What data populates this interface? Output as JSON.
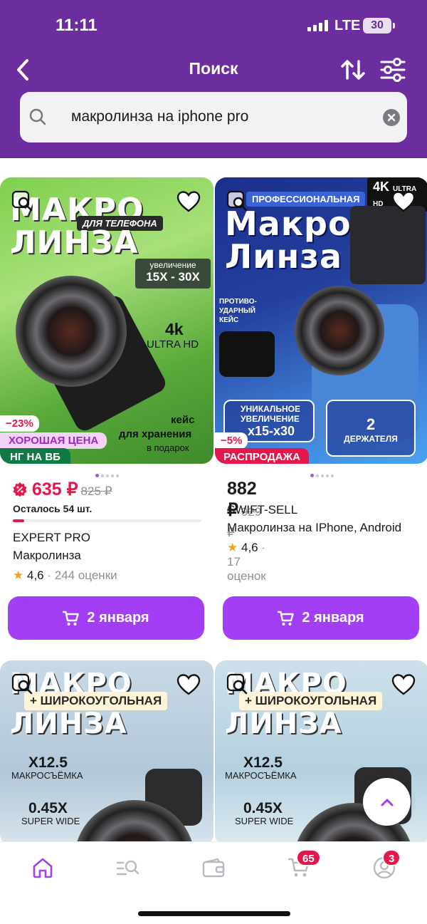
{
  "status_bar": {
    "time": "11:11",
    "network": "LTE",
    "battery": "30"
  },
  "header": {
    "title": "Поиск"
  },
  "search": {
    "query": "макролинза на iphone pro"
  },
  "products": [
    {
      "image_text": {
        "line1": "МАКРО",
        "tag": "ДЛЯ ТЕЛЕФОНА",
        "line2": "ЛИНЗА",
        "zoom_caption": "увеличение",
        "zoom": "15X - 30X",
        "res": "4k",
        "res_sub": "ULTRA HD",
        "case1": "кейс",
        "case2": "для хранения",
        "case3": "в подарок"
      },
      "discount": "−23%",
      "badge_good": "ХОРОШАЯ ЦЕНА",
      "badge_bottom": "НГ НА ВБ",
      "price": "635 ₽",
      "old_price": "825 ₽",
      "stock": "Осталось 54 шт.",
      "stock_fraction": 0.06,
      "brand": "EXPERT PRO",
      "name": "Макролинза",
      "rating": "4,6",
      "reviews": "244 оценки",
      "delivery": "2 января"
    },
    {
      "image_text": {
        "tag": "ПРОФЕССИОНАЛЬНАЯ",
        "line1": "Макро",
        "line2": "Линза",
        "res": "4K",
        "res_sub": "ULTRA HD",
        "case": "ПРОТИВО-УДАРНЫЙ КЕЙС",
        "unique1": "УНИКАЛЬНОЕ",
        "unique2": "УВЕЛИЧЕНИЕ",
        "zoom": "x15-x30",
        "holders_count": "2",
        "holders": "ДЕРЖАТЕЛЯ"
      },
      "discount": "−5%",
      "badge_bottom": "РАСПРОДАЖА",
      "price": "882 ₽",
      "old_price": "929 ₽",
      "brand": "SWIFT-SELL",
      "name": "Макролинза на IPhone, Android",
      "rating": "4,6",
      "reviews": "17 оценок",
      "delivery": "2 января"
    },
    {
      "image_text": {
        "line1": "МАКРО",
        "tag": "+ ШИРОКОУГОЛЬНАЯ",
        "line2": "ЛИНЗА",
        "zoom": "X12.5",
        "zoom_sub": "МАКРОСЪЁМКА",
        "wide": "0.45X",
        "wide_sub": "SUPER WIDE"
      }
    },
    {
      "image_text": {
        "line1": "МАКРО",
        "tag": "+ ШИРОКОУГОЛЬНАЯ",
        "line2": "ЛИНЗА",
        "zoom": "X12.5",
        "zoom_sub": "МАКРОСЪЁМКА",
        "wide": "0.45X",
        "wide_sub": "SUPER WIDE"
      }
    }
  ],
  "tabbar": {
    "cart_count": "65",
    "profile_count": "3"
  },
  "colors": {
    "brand_purple": "#6c2d9e",
    "button_purple": "#a23ef4",
    "sale_red": "#e5174a",
    "ng_green": "#117a44"
  }
}
